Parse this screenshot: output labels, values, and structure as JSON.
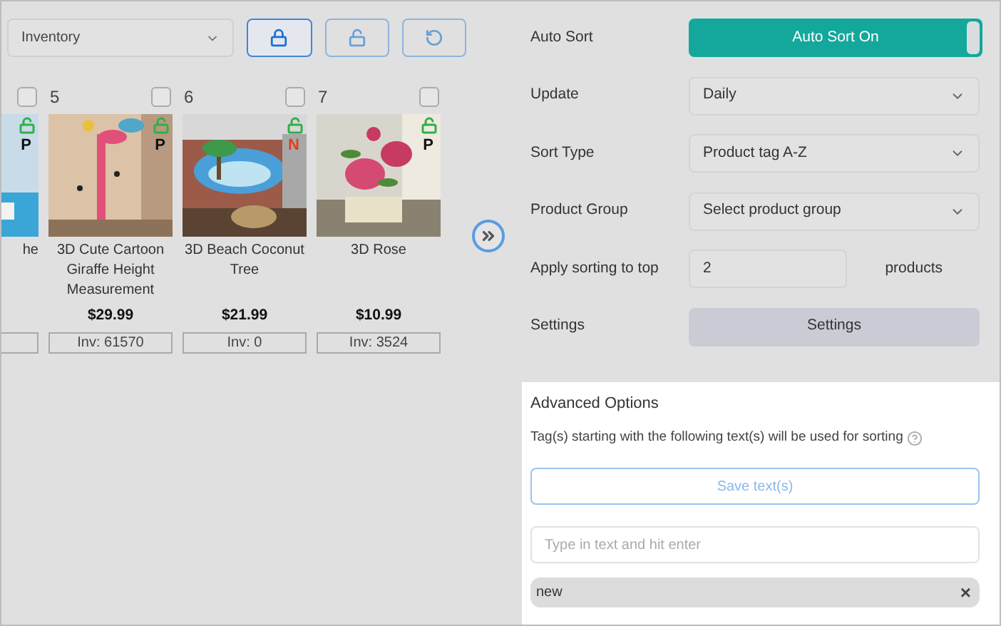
{
  "view_select": {
    "value": "Inventory"
  },
  "lock_buttons": [
    {
      "kind": "lock",
      "selected": true
    },
    {
      "kind": "unlock",
      "selected": false
    },
    {
      "kind": "reset",
      "selected": false
    }
  ],
  "products": [
    {
      "title": "he",
      "badge": "P",
      "color": "#111111",
      "checked": false
    },
    {
      "number": "5",
      "title": "3D Cute Cartoon Giraffe Height Measurement",
      "price": "$29.99",
      "inventory": "Inv: 61570",
      "badge": "P",
      "color": "#111111",
      "checked": false
    },
    {
      "number": "6",
      "title": "3D Beach Coconut Tree",
      "price": "$21.99",
      "inventory": "Inv: 0",
      "badge": "N",
      "color": "#e0401c",
      "checked": false
    },
    {
      "number": "7",
      "title": "3D Rose",
      "price": "$10.99",
      "inventory": "Inv: 3524",
      "badge": "P",
      "color": "#111111",
      "checked": false
    }
  ],
  "settings": [
    {
      "kind": "toggle",
      "label": "Auto Sort",
      "value": "Auto Sort On",
      "on": true
    },
    {
      "kind": "select",
      "label": "Update",
      "value": "Daily"
    },
    {
      "kind": "select",
      "label": "Sort Type",
      "value": "Product tag A-Z"
    },
    {
      "kind": "select",
      "label": "Product Group",
      "value": "Select product group"
    },
    {
      "kind": "number",
      "label": "Apply sorting to top",
      "value": "2",
      "suffix": "products"
    },
    {
      "kind": "button",
      "label": "Settings",
      "value": "Settings"
    }
  ],
  "advanced": {
    "title": "Advanced Options",
    "description": "Tag(s) starting with the following text(s) will be used for sorting",
    "save_button": "Save text(s)",
    "placeholder": "Type in text and hit enter",
    "tags": [
      {
        "label": "new",
        "remove": "×"
      }
    ]
  }
}
